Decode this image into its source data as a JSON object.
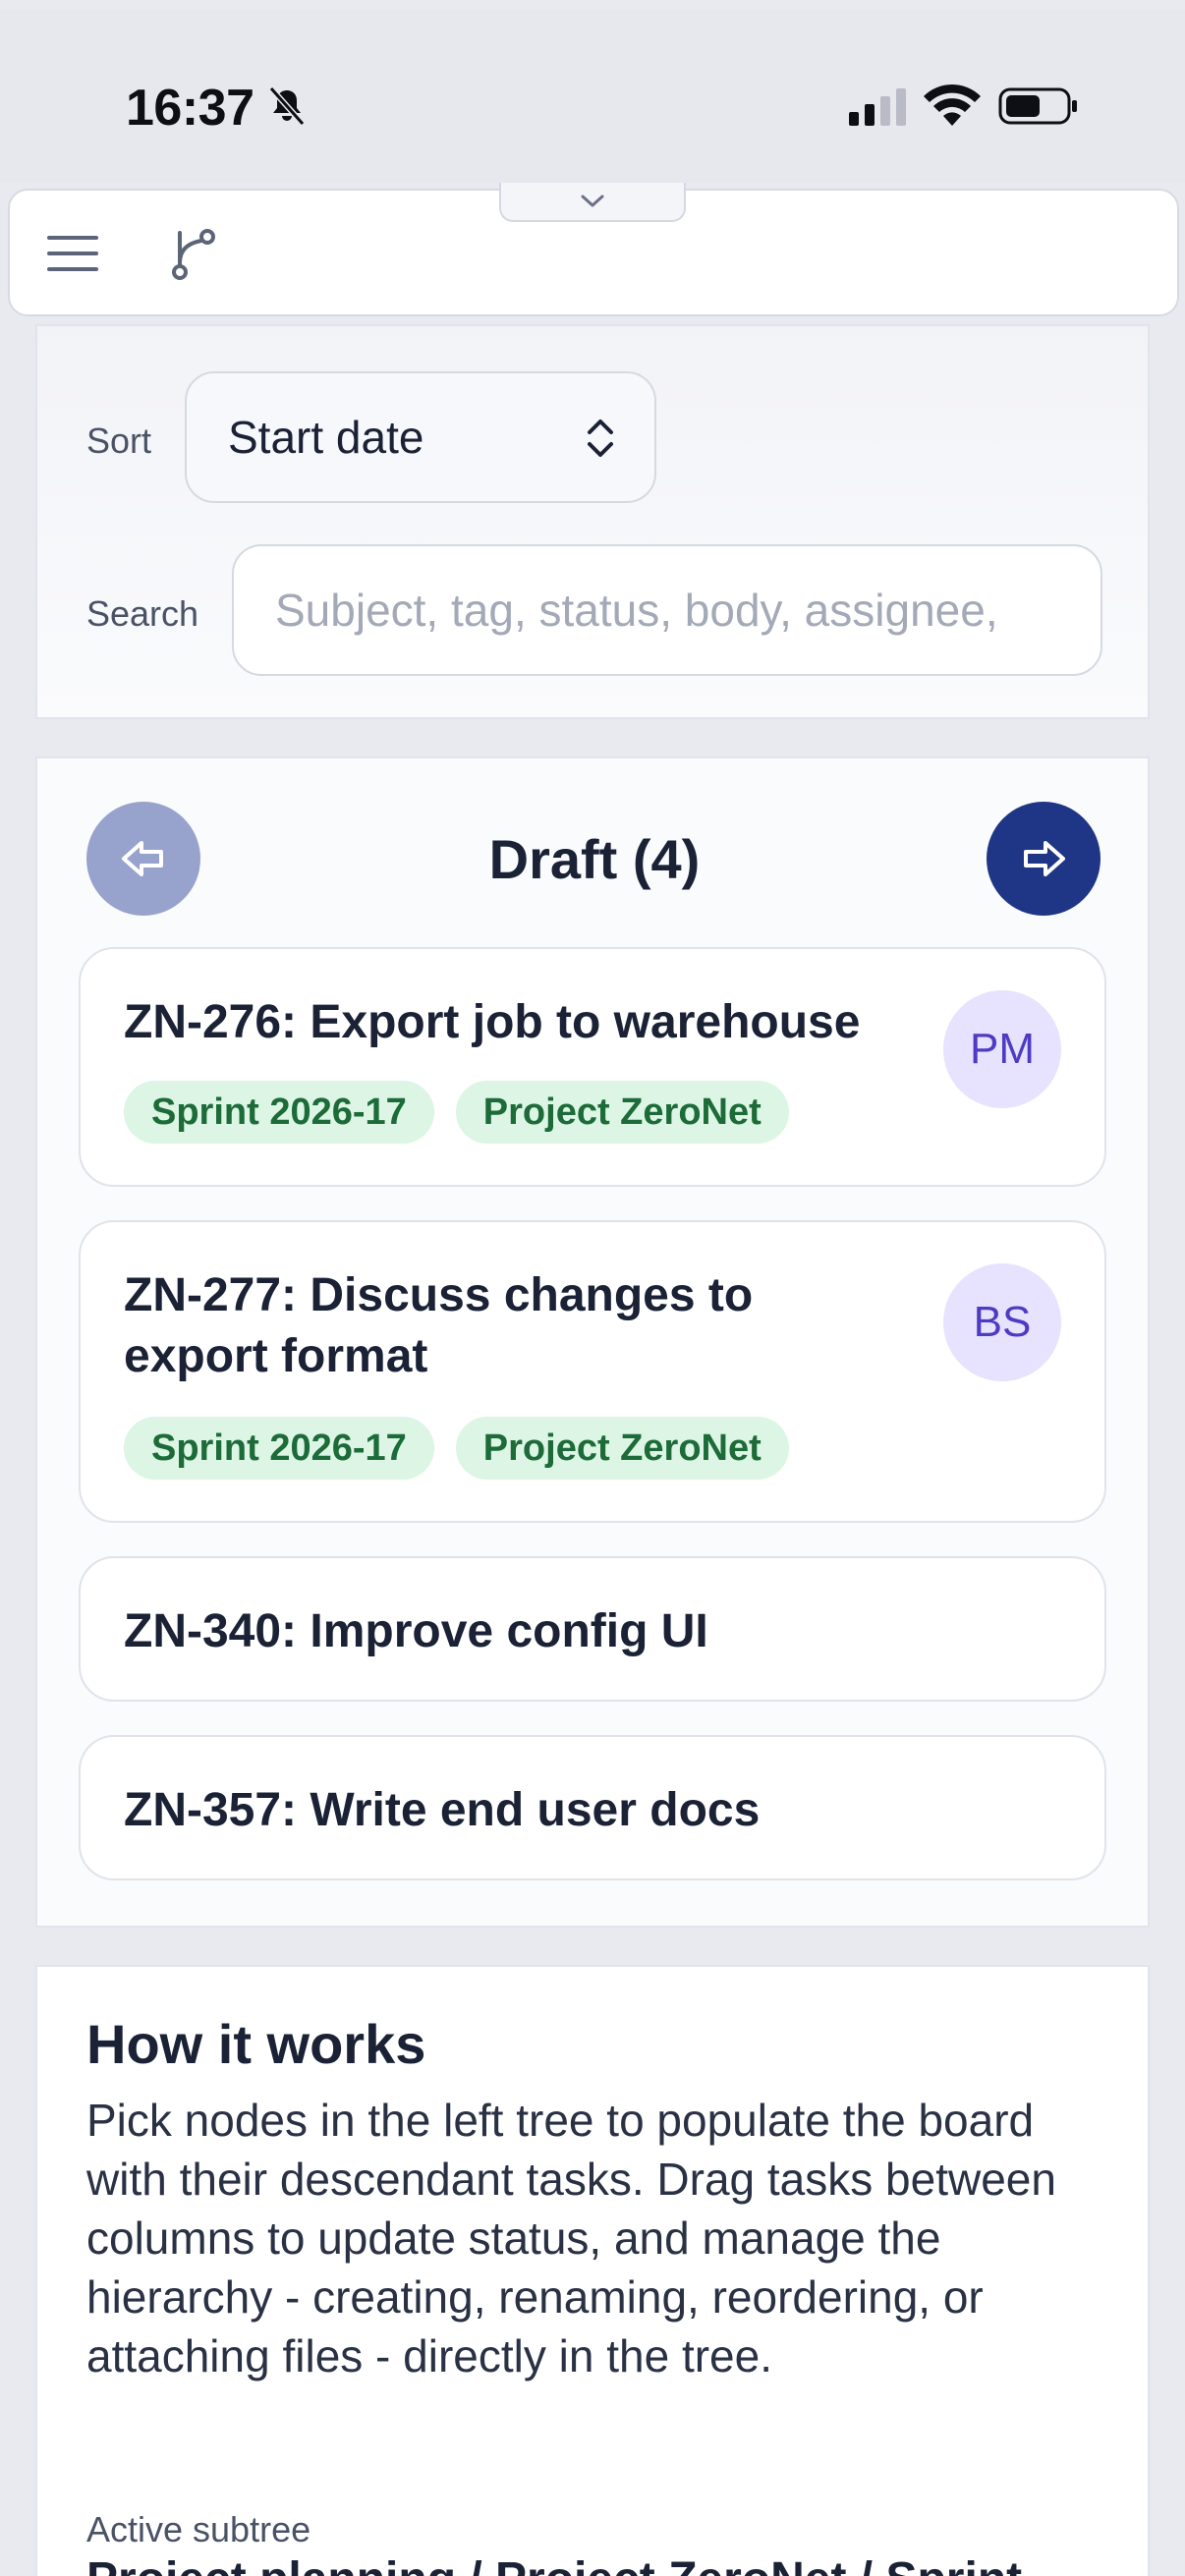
{
  "status_bar": {
    "time": "16:37",
    "icons": [
      "bell-slash-icon",
      "cellular-signal-icon",
      "wifi-icon",
      "battery-icon"
    ]
  },
  "toolbar": {
    "icons": [
      "menu-icon",
      "branch-icon",
      "chevron-down-icon"
    ]
  },
  "filters": {
    "sort_label": "Sort",
    "sort_value": "Start date",
    "search_label": "Search",
    "search_placeholder": "Subject, tag, status, body, assignee,"
  },
  "column": {
    "title": "Draft (4)",
    "prev_icon": "arrow-left-icon",
    "next_icon": "arrow-right-icon",
    "cards": [
      {
        "title": "ZN-276: Export job to warehouse",
        "avatar": "PM",
        "tags": [
          "Sprint 2026-17",
          "Project ZeroNet"
        ]
      },
      {
        "title": "ZN-277: Discuss changes to export format",
        "avatar": "BS",
        "tags": [
          "Sprint 2026-17",
          "Project ZeroNet"
        ]
      },
      {
        "title": "ZN-340: Improve config UI"
      },
      {
        "title": "ZN-357: Write end user docs"
      }
    ]
  },
  "info": {
    "title": "How it works",
    "body": "Pick nodes in the left tree to populate the board with their descendant tasks. Drag tasks between columns to update status, and manage the hierarchy - creating, renaming, reordering, or attaching files - directly in the tree.",
    "subtree_label": "Active subtree",
    "subtree_value": "Project planning / Project ZeroNet / Sprint"
  },
  "colors": {
    "accent": "#1f3585",
    "accent_disabled": "#97a3cc",
    "tag_bg": "#dcf5e4",
    "tag_text": "#1c6b38",
    "avatar_bg": "#e7e2fd",
    "avatar_text": "#4e3bc4"
  }
}
